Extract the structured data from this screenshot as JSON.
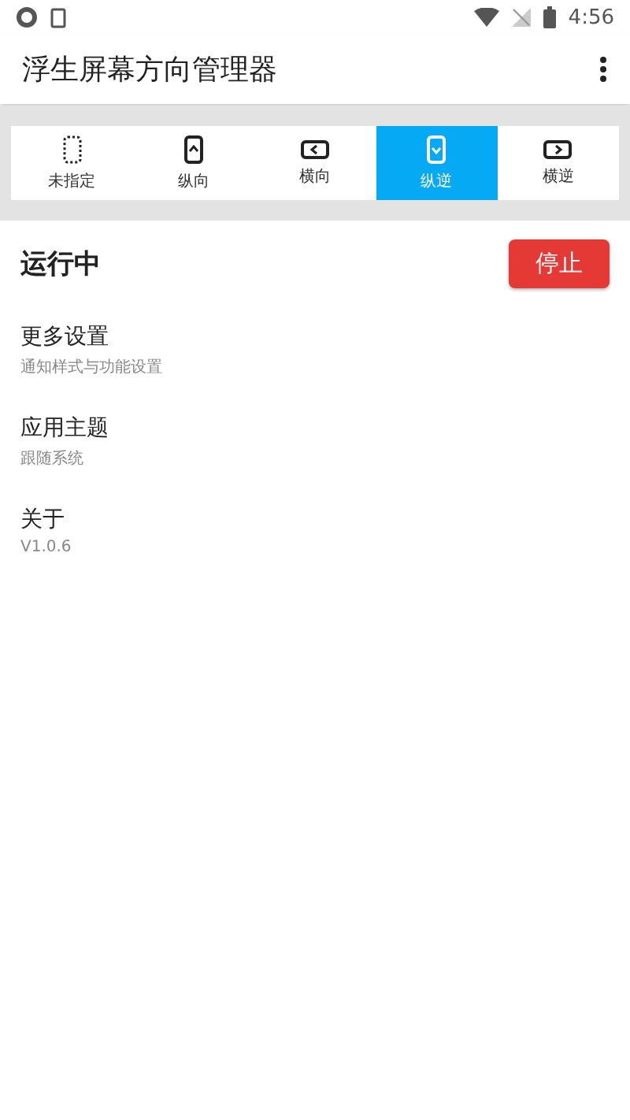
{
  "status_bar": {
    "time": "4:56"
  },
  "app_bar": {
    "title": "浮生屏幕方向管理器"
  },
  "orientations": [
    {
      "kind": "unspecified",
      "label": "未指定",
      "selected": false
    },
    {
      "kind": "portrait",
      "label": "纵向",
      "selected": false
    },
    {
      "kind": "landscape",
      "label": "横向",
      "selected": false
    },
    {
      "kind": "reverse-portrait",
      "label": "纵逆",
      "selected": true
    },
    {
      "kind": "reverse-landscape",
      "label": "横逆",
      "selected": false
    }
  ],
  "status": {
    "label": "运行中",
    "button": "停止"
  },
  "settings": [
    {
      "title": "更多设置",
      "subtitle": "通知样式与功能设置"
    },
    {
      "title": "应用主题",
      "subtitle": "跟随系统"
    },
    {
      "title": "关于",
      "subtitle": "V1.0.6"
    }
  ]
}
